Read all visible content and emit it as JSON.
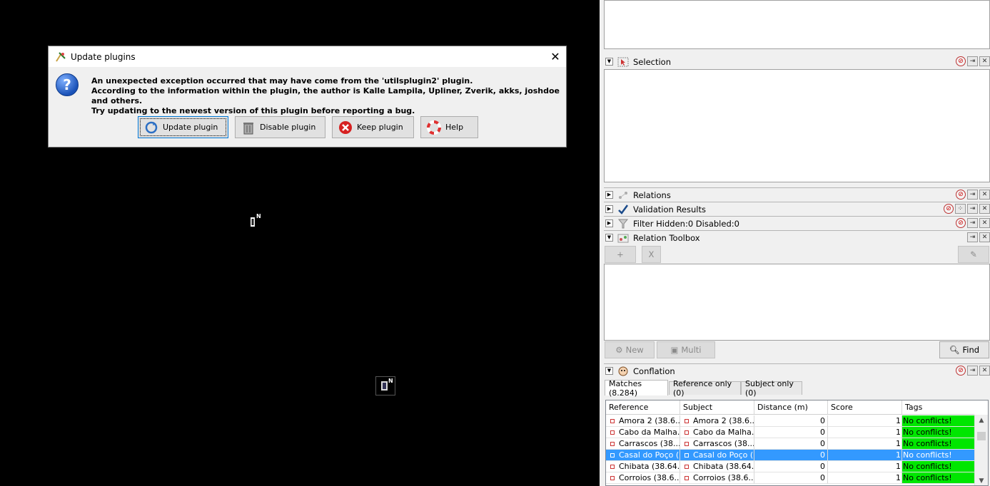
{
  "dialog": {
    "title": "Update plugins",
    "close_label": "✕",
    "icon": "question-icon",
    "message_lines": [
      "An unexpected exception occurred that may have come from the 'utilsplugin2' plugin.",
      "According to the information within the plugin, the author is Kalle Lampila, Upliner, Zverik, akks, joshdoe and others.",
      "Try updating to the newest version of this plugin before reporting a bug."
    ],
    "buttons": {
      "update": "Update plugin",
      "disable": "Disable plugin",
      "keep": "Keep plugin",
      "help": "Help"
    }
  },
  "map": {
    "marker1_label": "N",
    "marker2_label": "N"
  },
  "panels": {
    "selection": {
      "title": "Selection",
      "icon": "selection-icon"
    },
    "relations": {
      "title": "Relations",
      "icon": "relations-icon"
    },
    "validation": {
      "title": "Validation Results",
      "icon": "checkmark-icon"
    },
    "filter": {
      "title": "Filter Hidden:0 Disabled:0",
      "icon": "filter-icon"
    },
    "toolbox": {
      "title": "Relation Toolbox",
      "icon": "toolbox-icon",
      "add_label": "+",
      "x_label": "X",
      "new_label": "New",
      "multi_label": "Multi",
      "find_label": "Find"
    },
    "conflation": {
      "title": "Conflation",
      "icon": "conflation-icon",
      "tabs": [
        "Matches (8.284)",
        "Reference only (0)",
        "Subject only (0)"
      ],
      "columns": [
        "Reference",
        "Subject",
        "Distance (m)",
        "Score",
        "Tags"
      ],
      "rows": [
        {
          "ref": "Amora 2 (38.6...",
          "sub": "Amora 2 (38.6...",
          "dist": "0",
          "score": "1",
          "tags": "No conflicts!"
        },
        {
          "ref": "Cabo da Malha...",
          "sub": "Cabo da Malha...",
          "dist": "0",
          "score": "1",
          "tags": "No conflicts!"
        },
        {
          "ref": "Carrascos (38....",
          "sub": "Carrascos (38....",
          "dist": "0",
          "score": "1",
          "tags": "No conflicts!"
        },
        {
          "ref": "Casal do Poço (...",
          "sub": "Casal do Poço (...",
          "dist": "0",
          "score": "1",
          "tags": "No conflicts!"
        },
        {
          "ref": "Chibata (38.64...",
          "sub": "Chibata (38.64...",
          "dist": "0",
          "score": "1",
          "tags": "No conflicts!"
        },
        {
          "ref": "Corroios (38.6...",
          "sub": "Corroios (38.6...",
          "dist": "0",
          "score": "1",
          "tags": "No conflicts!"
        }
      ],
      "selected_row": 3
    }
  }
}
